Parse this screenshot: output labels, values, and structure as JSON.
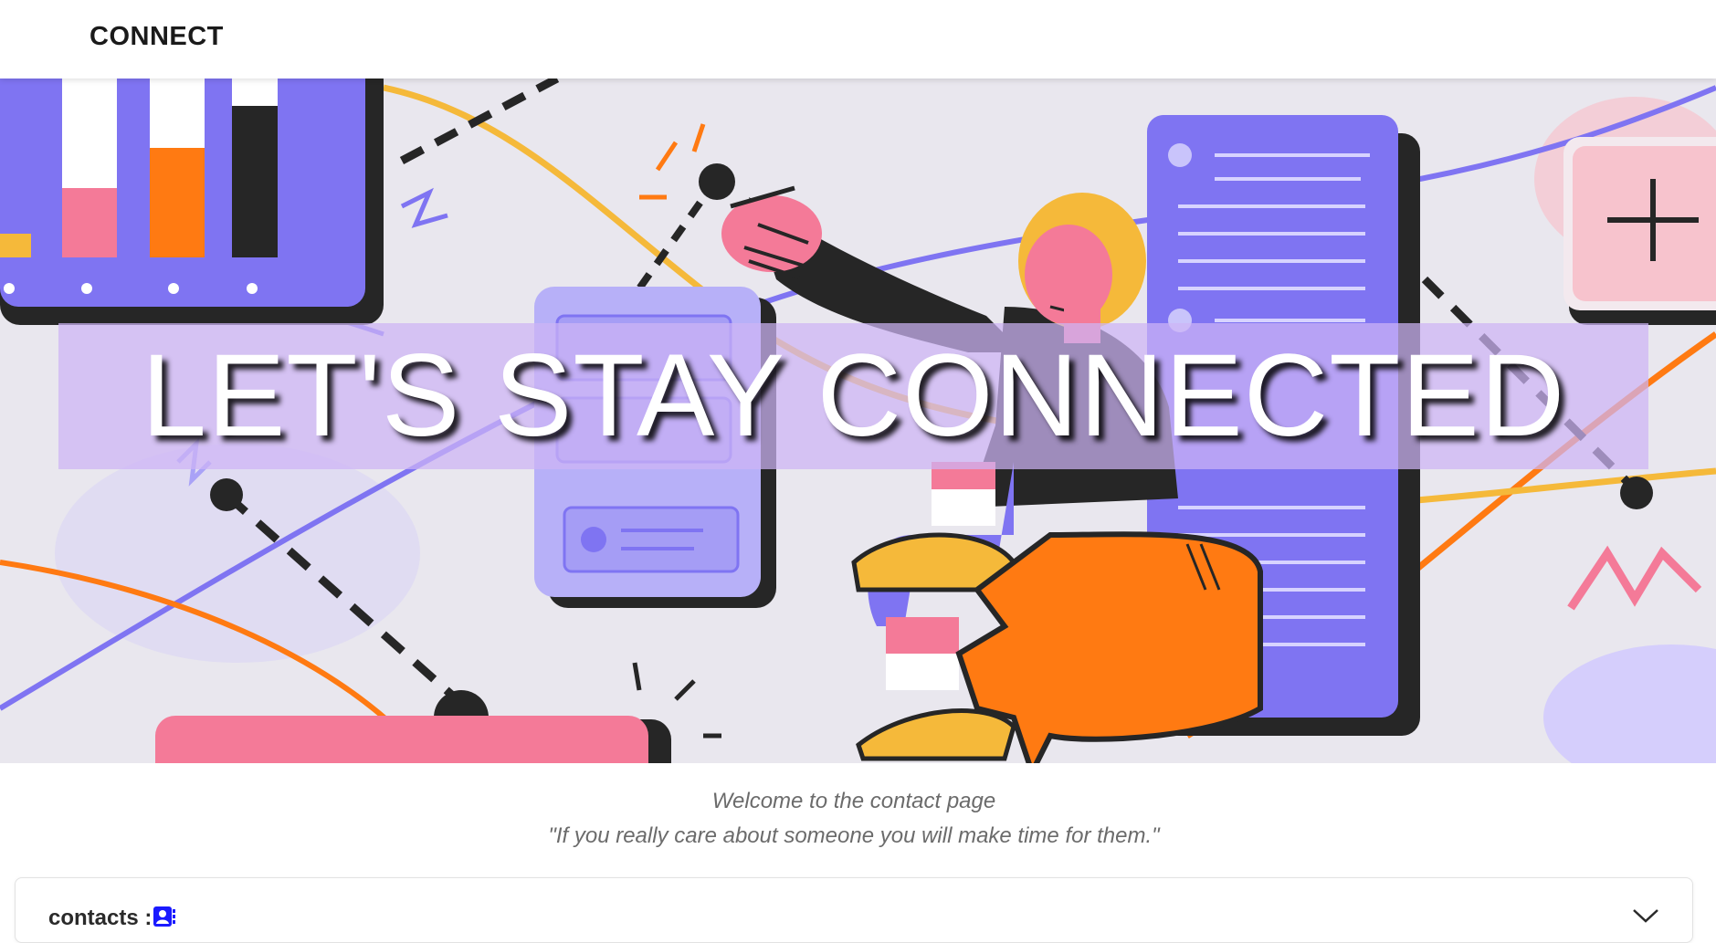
{
  "navbar": {
    "brand": "CONNECT"
  },
  "hero": {
    "title": "LET'S STAY CONNECTED",
    "colors": {
      "banner": "#cdb4f5",
      "purple": "#7f74f2",
      "orange": "#ff7a12",
      "pink": "#f47a98",
      "yellow": "#f5b93a",
      "dark": "#262626"
    }
  },
  "intro": {
    "welcome": "Welcome to the contact page",
    "quote": "\"If you really care about someone you will make time for them.\""
  },
  "contacts": {
    "label": "contacts :",
    "icon": "contact-card-icon",
    "toggle_icon": "chevron-down-icon",
    "icon_color": "#1a1aff"
  }
}
